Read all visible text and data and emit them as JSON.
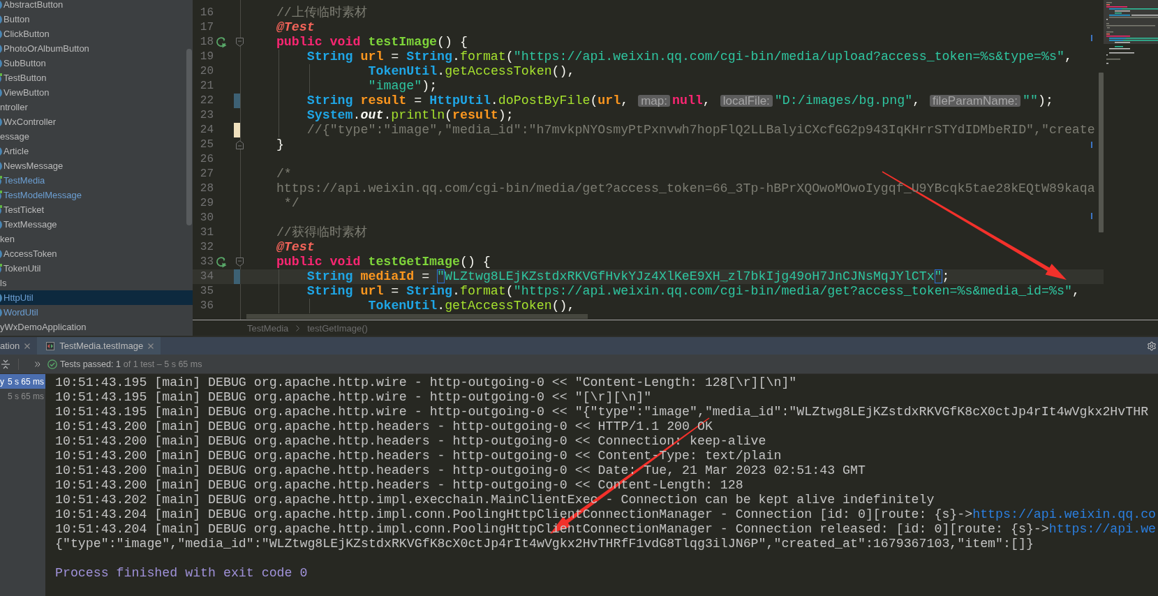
{
  "project_tree": {
    "items": [
      {
        "label": "AbstractButton",
        "kind": "class",
        "modified": false,
        "selected": false
      },
      {
        "label": "Button",
        "kind": "class",
        "modified": false,
        "selected": false
      },
      {
        "label": "ClickButton",
        "kind": "class",
        "modified": false,
        "selected": false
      },
      {
        "label": "PhotoOrAlbumButton",
        "kind": "class",
        "modified": false,
        "selected": false
      },
      {
        "label": "SubButton",
        "kind": "class",
        "modified": false,
        "selected": false
      },
      {
        "label": "TestButton",
        "kind": "test",
        "modified": false,
        "selected": false
      },
      {
        "label": "ViewButton",
        "kind": "class",
        "modified": false,
        "selected": false
      },
      {
        "label": "ntroller",
        "kind": "plain",
        "modified": false,
        "selected": false
      },
      {
        "label": "WxController",
        "kind": "class",
        "modified": false,
        "selected": false
      },
      {
        "label": "essage",
        "kind": "plain",
        "modified": false,
        "selected": false
      },
      {
        "label": "Article",
        "kind": "class",
        "modified": false,
        "selected": false
      },
      {
        "label": "NewsMessage",
        "kind": "class",
        "modified": false,
        "selected": false
      },
      {
        "label": "TestMedia",
        "kind": "test",
        "modified": true,
        "selected": false
      },
      {
        "label": "TestModelMessage",
        "kind": "test",
        "modified": true,
        "selected": false
      },
      {
        "label": "TestTicket",
        "kind": "test",
        "modified": false,
        "selected": false
      },
      {
        "label": "TextMessage",
        "kind": "class",
        "modified": false,
        "selected": false
      },
      {
        "label": "ken",
        "kind": "plain",
        "modified": false,
        "selected": false
      },
      {
        "label": "AccessToken",
        "kind": "class",
        "modified": false,
        "selected": false
      },
      {
        "label": "TokenUtil",
        "kind": "test",
        "modified": false,
        "selected": false
      },
      {
        "label": "ls",
        "kind": "plain",
        "modified": false,
        "selected": false
      },
      {
        "label": "HttpUtil",
        "kind": "class",
        "modified": true,
        "selected": true
      },
      {
        "label": "WordUtil",
        "kind": "class",
        "modified": true,
        "selected": false
      },
      {
        "label": "yWxDemoApplication",
        "kind": "plain",
        "modified": false,
        "selected": false
      }
    ]
  },
  "editor": {
    "lines": [
      {
        "number": "16",
        "current": false,
        "tokens": [
          {
            "kind": "comment",
            "text": "//上传临时素材"
          }
        ]
      },
      {
        "number": "17",
        "current": false,
        "tokens": [
          {
            "kind": "annotation",
            "text": "@Test"
          }
        ]
      },
      {
        "number": "18",
        "current": false,
        "marks": [
          {
            "kind": "run"
          },
          {
            "kind": "fold_start"
          }
        ],
        "tokens": [
          {
            "kind": "keyword",
            "text": "public void "
          },
          {
            "kind": "method_decl",
            "text": "testImage"
          },
          {
            "kind": "plain",
            "text": "() {"
          }
        ],
        "children": [
          {
            "number": "19",
            "current": false,
            "tokens": [
              {
                "kind": "type",
                "text": "String "
              },
              {
                "kind": "variable",
                "text": "url"
              },
              {
                "kind": "plain",
                "text": " = "
              },
              {
                "kind": "type",
                "text": "String"
              },
              {
                "kind": "plain",
                "text": "."
              },
              {
                "kind": "method_call",
                "text": "format"
              },
              {
                "kind": "plain",
                "text": "("
              },
              {
                "kind": "string",
                "text": "\"https://api.weixin.qq.com/cgi-bin/media/upload?access_token=%s&type=%s\""
              },
              {
                "kind": "plain",
                "text": ","
              }
            ],
            "continuation": [
              {
                "number": "20",
                "current": false,
                "tokens": [
                  {
                    "kind": "type",
                    "text": "TokenUtil"
                  },
                  {
                    "kind": "plain",
                    "text": "."
                  },
                  {
                    "kind": "method_call",
                    "text": "getAccessToken"
                  },
                  {
                    "kind": "plain",
                    "text": "(),"
                  }
                ]
              },
              {
                "number": "21",
                "current": false,
                "tokens": [
                  {
                    "kind": "string",
                    "text": "\"image\""
                  },
                  {
                    "kind": "plain",
                    "text": ");"
                  }
                ]
              }
            ]
          },
          {
            "number": "22",
            "current": false,
            "marks": [
              {
                "kind": "modified"
              }
            ],
            "tokens": [
              {
                "kind": "type",
                "text": "String "
              },
              {
                "kind": "variable",
                "text": "result"
              },
              {
                "kind": "plain",
                "text": " = "
              },
              {
                "kind": "type",
                "text": "HttpUtil"
              },
              {
                "kind": "plain",
                "text": "."
              },
              {
                "kind": "method_call",
                "text": "doPostByFile"
              },
              {
                "kind": "plain",
                "text": "("
              },
              {
                "kind": "variable",
                "text": "url"
              },
              {
                "kind": "plain",
                "text": ", "
              },
              {
                "kind": "hint",
                "text": "map:"
              },
              {
                "kind": "keyword",
                "text": "null"
              },
              {
                "kind": "plain",
                "text": ", "
              },
              {
                "kind": "hint",
                "text": "localFile:"
              },
              {
                "kind": "string",
                "text": "\"D:/images/bg.png\""
              },
              {
                "kind": "plain",
                "text": ", "
              },
              {
                "kind": "hint",
                "text": "fileParamName:"
              },
              {
                "kind": "string",
                "text": "\"\""
              },
              {
                "kind": "plain",
                "text": ");"
              }
            ]
          },
          {
            "number": "23",
            "current": false,
            "tokens": [
              {
                "kind": "type",
                "text": "System"
              },
              {
                "kind": "plain",
                "text": "."
              },
              {
                "kind": "static_field",
                "text": "out"
              },
              {
                "kind": "plain",
                "text": "."
              },
              {
                "kind": "method_call",
                "text": "println"
              },
              {
                "kind": "plain",
                "text": "("
              },
              {
                "kind": "variable",
                "text": "result"
              },
              {
                "kind": "plain",
                "text": ");"
              }
            ]
          },
          {
            "number": "24",
            "current": false,
            "marks": [
              {
                "kind": "added"
              }
            ],
            "tokens": [
              {
                "kind": "comment",
                "text": "//{\"type\":\"image\",\"media_id\":\"h7mvkpNYOsmyPtPxnvwh7hopFlQ2LLBalyiCXcfGG2p943IqKHrrSTYdIDMbeRID\",\"create"
              }
            ]
          }
        ]
      },
      {
        "number": "25",
        "current": false,
        "marks": [
          {
            "kind": "fold_end"
          }
        ],
        "tokens": [
          {
            "kind": "plain",
            "text": "}"
          }
        ]
      },
      {
        "number": "26",
        "current": false
      },
      {
        "number": "27",
        "current": false,
        "tokens": [
          {
            "kind": "comment",
            "text": "/*"
          }
        ]
      },
      {
        "number": "28",
        "current": false,
        "tokens": [
          {
            "kind": "comment",
            "text": "https://api.weixin.qq.com/cgi-bin/media/get?access_token=66_3Tp-hBPrXQOwoMOwoIygqf_U9YBcqk5tae28kEQtW89kaqa"
          }
        ]
      },
      {
        "number": "29",
        "current": false,
        "tokens": [
          {
            "kind": "comment",
            "text": " */"
          }
        ]
      },
      {
        "number": "30",
        "current": false
      },
      {
        "number": "31",
        "current": false,
        "tokens": [
          {
            "kind": "comment",
            "text": "//获得临时素材"
          }
        ]
      },
      {
        "number": "32",
        "current": false,
        "tokens": [
          {
            "kind": "annotation",
            "text": "@Test"
          }
        ]
      },
      {
        "number": "33",
        "current": false,
        "marks": [
          {
            "kind": "run"
          },
          {
            "kind": "fold_start"
          }
        ],
        "tokens": [
          {
            "kind": "keyword",
            "text": "public void "
          },
          {
            "kind": "method_decl",
            "text": "testGetImage"
          },
          {
            "kind": "plain",
            "text": "() {"
          }
        ],
        "children": [
          {
            "number": "34",
            "current": true,
            "marks": [
              {
                "kind": "modified"
              }
            ],
            "tokens": [
              {
                "kind": "type",
                "text": "String "
              },
              {
                "kind": "variable",
                "text": "mediaId"
              },
              {
                "kind": "plain",
                "text": " = "
              },
              {
                "kind": "match",
                "text": "\""
              },
              {
                "kind": "string",
                "text": "WLZtwg8LEjKZstdxRKVGfHvkYJz4XlKeE9XH_zl7bkIjg49oH7JnCJNsMqJYlCTx"
              },
              {
                "kind": "match",
                "text": "\""
              },
              {
                "kind": "plain",
                "text": ";"
              }
            ]
          },
          {
            "number": "35",
            "current": false,
            "tokens": [
              {
                "kind": "type",
                "text": "String "
              },
              {
                "kind": "variable",
                "text": "url"
              },
              {
                "kind": "plain",
                "text": " = "
              },
              {
                "kind": "type",
                "text": "String"
              },
              {
                "kind": "plain",
                "text": "."
              },
              {
                "kind": "method_call",
                "text": "format"
              },
              {
                "kind": "plain",
                "text": "("
              },
              {
                "kind": "string",
                "text": "\"https://api.weixin.qq.com/cgi-bin/media/get?access_token=%s&media_id=%s\""
              },
              {
                "kind": "plain",
                "text": ","
              }
            ],
            "continuation": [
              {
                "number": "36",
                "current": false,
                "tokens": [
                  {
                    "kind": "type",
                    "text": "TokenUtil"
                  },
                  {
                    "kind": "plain",
                    "text": "."
                  },
                  {
                    "kind": "method_call",
                    "text": "getAccessToken"
                  },
                  {
                    "kind": "plain",
                    "text": "(),"
                  }
                ]
              }
            ]
          }
        ]
      }
    ],
    "breadcrumb": [
      "TestMedia",
      "testGetImage()"
    ]
  },
  "run_panel": {
    "tabs": [
      {
        "label": "ation",
        "selected": false
      },
      {
        "label": "TestMedia.testImage",
        "selected": true
      }
    ],
    "toolbar": {
      "status": "Tests passed: 1",
      "detail": "of 1 test – 5 s 65 ms"
    },
    "test_tree": [
      {
        "name": "y",
        "time": "5 s 65 ms",
        "selected": true
      },
      {
        "time": "5 s 65 ms",
        "selected": false
      }
    ],
    "console": [
      {
        "kind": "log",
        "text": "10:51:43.195 [main] DEBUG org.apache.http.wire - http-outgoing-0 << \"Content-Length: 128[\\r][\\n]\""
      },
      {
        "kind": "log",
        "text": "10:51:43.195 [main] DEBUG org.apache.http.wire - http-outgoing-0 << \"[\\r][\\n]\""
      },
      {
        "kind": "log",
        "text": "10:51:43.195 [main] DEBUG org.apache.http.wire - http-outgoing-0 << \"{\"type\":\"image\",\"media_id\":\"WLZtwg8LEjKZstdxRKVGfK8cX0ctJp4rIt4wVgkx2HvTHR"
      },
      {
        "kind": "log",
        "text": "10:51:43.200 [main] DEBUG org.apache.http.headers - http-outgoing-0 << HTTP/1.1 200 OK"
      },
      {
        "kind": "log",
        "text": "10:51:43.200 [main] DEBUG org.apache.http.headers - http-outgoing-0 << Connection: keep-alive"
      },
      {
        "kind": "log",
        "text": "10:51:43.200 [main] DEBUG org.apache.http.headers - http-outgoing-0 << Content-Type: text/plain"
      },
      {
        "kind": "log",
        "text": "10:51:43.200 [main] DEBUG org.apache.http.headers - http-outgoing-0 << Date: Tue, 21 Mar 2023 02:51:43 GMT"
      },
      {
        "kind": "log",
        "text": "10:51:43.200 [main] DEBUG org.apache.http.headers - http-outgoing-0 << Content-Length: 128"
      },
      {
        "kind": "log",
        "text": "10:51:43.202 [main] DEBUG org.apache.http.impl.execchain.MainClientExec - Connection can be kept alive indefinitely"
      },
      {
        "kind": "log",
        "text": "10:51:43.204 [main] DEBUG org.apache.http.impl.conn.PoolingHttpClientConnectionManager - Connection [id: 0][route: {s}->",
        "link": "https://api.weixin.qq.co"
      },
      {
        "kind": "log",
        "text": "10:51:43.204 [main] DEBUG org.apache.http.impl.conn.PoolingHttpClientConnectionManager - Connection released: [id: 0][route: {s}->",
        "link": "https://api.we"
      },
      {
        "kind": "log",
        "text": "{\"type\":\"image\",\"media_id\":\"WLZtwg8LEjKZstdxRKVGfK8cX0ctJp4rIt4wVgkx2HvTHRfF1vdG8Tlqg3ilJN6P\",\"created_at\":1679367103,\"item\":[]}"
      },
      {
        "kind": "exit",
        "text": "Process finished with exit code 0"
      }
    ]
  },
  "annotations": [
    {
      "kind": "arrow"
    },
    {
      "kind": "arrow"
    }
  ]
}
